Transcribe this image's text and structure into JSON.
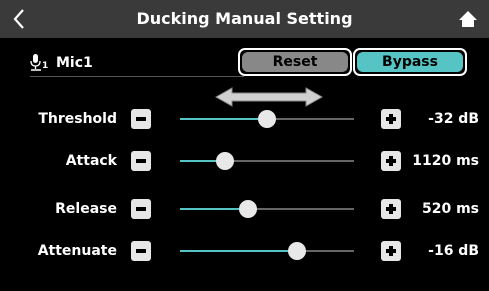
{
  "header": {
    "title": "Ducking Manual Setting",
    "back_icon": "chevron-left-icon",
    "home_icon": "home-icon"
  },
  "channel": {
    "name": "Mic1",
    "icon": "microphone-icon",
    "icon_subscript": "1"
  },
  "buttons": {
    "reset_label": "Reset",
    "bypass_label": "Bypass",
    "bypass_color": "#56c4c4",
    "reset_color": "#888888"
  },
  "drag_hint_icon": "double-arrow-icon",
  "accent_color": "#56c4c4",
  "params": [
    {
      "key": "threshold",
      "label": "Threshold",
      "value": "-32 dB",
      "level": 0.5
    },
    {
      "key": "attack",
      "label": "Attack",
      "value": "1120 ms",
      "level": 0.26
    },
    {
      "key": "release",
      "label": "Release",
      "value": "520 ms",
      "level": 0.39
    },
    {
      "key": "attenuate",
      "label": "Attenuate",
      "value": "-16 dB",
      "level": 0.67
    }
  ]
}
